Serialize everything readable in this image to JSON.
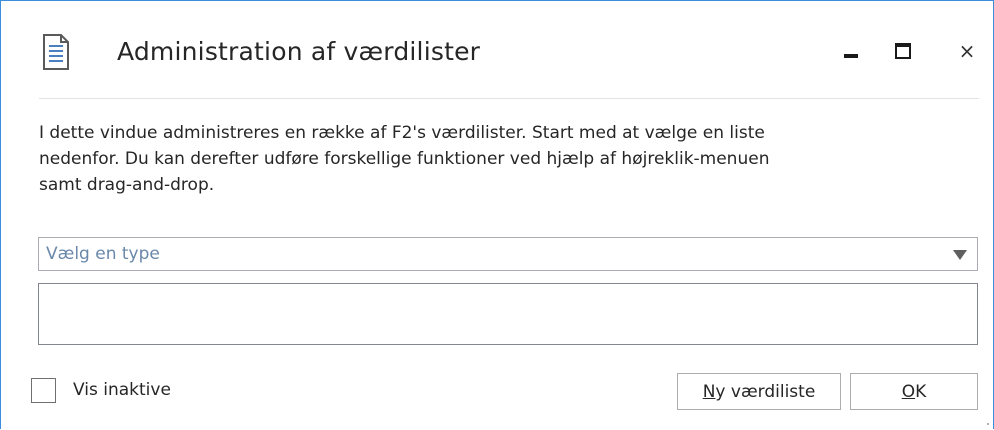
{
  "window": {
    "title": "Administration af værdilister",
    "icon": "document-list-icon",
    "controls": {
      "minimize": "minimize-icon",
      "maximize": "maximize-icon",
      "close": "×"
    }
  },
  "description": "I dette vindue administreres en række af F2's værdilister. Start med at vælge en liste\nnedenfor. Du kan derefter udføre forskellige funktioner ved hjælp af højreklik-menuen\nsamt drag-and-drop.",
  "type_select": {
    "placeholder": "Vælg en type",
    "icon": "chevron-down-icon"
  },
  "list": {
    "items": []
  },
  "footer": {
    "show_inactive": {
      "label": "Vis inaktive",
      "checked": false
    },
    "new_list_button": {
      "mnemonic": "N",
      "label_rest": "y værdiliste"
    },
    "ok_button": {
      "mnemonic": "O",
      "label_rest": "K"
    }
  },
  "colors": {
    "window_border": "#3c8dde",
    "placeholder_text": "#6a88aa",
    "text": "#262626"
  }
}
